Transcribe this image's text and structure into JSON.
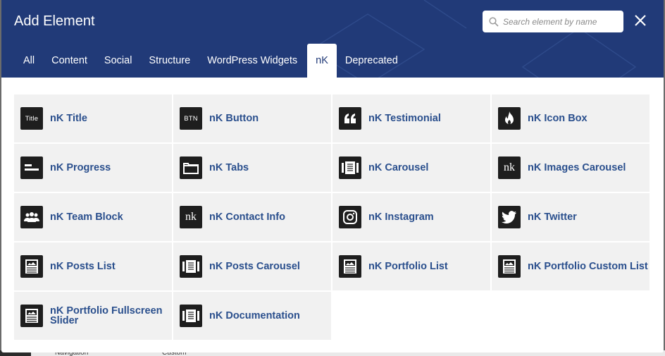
{
  "modal": {
    "title": "Add Element",
    "search_placeholder": "Search element by name"
  },
  "tabs": [
    {
      "label": "All"
    },
    {
      "label": "Content"
    },
    {
      "label": "Social"
    },
    {
      "label": "Structure"
    },
    {
      "label": "WordPress Widgets"
    },
    {
      "label": "nK",
      "active": true
    },
    {
      "label": "Deprecated"
    }
  ],
  "elements": [
    {
      "label": "nK Title",
      "icon": "title-text-icon",
      "icon_text": "Title"
    },
    {
      "label": "nK Button",
      "icon": "button-icon",
      "icon_text": "BTN"
    },
    {
      "label": "nK Testimonial",
      "icon": "quote-icon"
    },
    {
      "label": "nK Icon Box",
      "icon": "flame-icon"
    },
    {
      "label": "nK Progress",
      "icon": "progress-icon"
    },
    {
      "label": "nK Tabs",
      "icon": "tabs-icon"
    },
    {
      "label": "nK Carousel",
      "icon": "carousel-icon"
    },
    {
      "label": "nK Images Carousel",
      "icon": "nk-logo-icon",
      "icon_text": "nk"
    },
    {
      "label": "nK Team Block",
      "icon": "team-icon"
    },
    {
      "label": "nK Contact Info",
      "icon": "nk-logo-icon",
      "icon_text": "nk"
    },
    {
      "label": "nK Instagram",
      "icon": "instagram-icon"
    },
    {
      "label": "nK Twitter",
      "icon": "twitter-icon"
    },
    {
      "label": "nK Posts List",
      "icon": "post-icon"
    },
    {
      "label": "nK Posts Carousel",
      "icon": "carousel-icon"
    },
    {
      "label": "nK Portfolio List",
      "icon": "post-icon"
    },
    {
      "label": "nK Portfolio Custom List",
      "icon": "post-icon"
    },
    {
      "label": "nK Portfolio Fullscreen Slider",
      "icon": "post-icon"
    },
    {
      "label": "nK Documentation",
      "icon": "carousel-icon"
    }
  ],
  "background": {
    "left_text": "Navigation",
    "right_text": "Custom"
  },
  "colors": {
    "header": "#213a78",
    "card": "#f1f1f1",
    "label": "#2a4f8d",
    "icon_bg": "#1e1e1e"
  }
}
